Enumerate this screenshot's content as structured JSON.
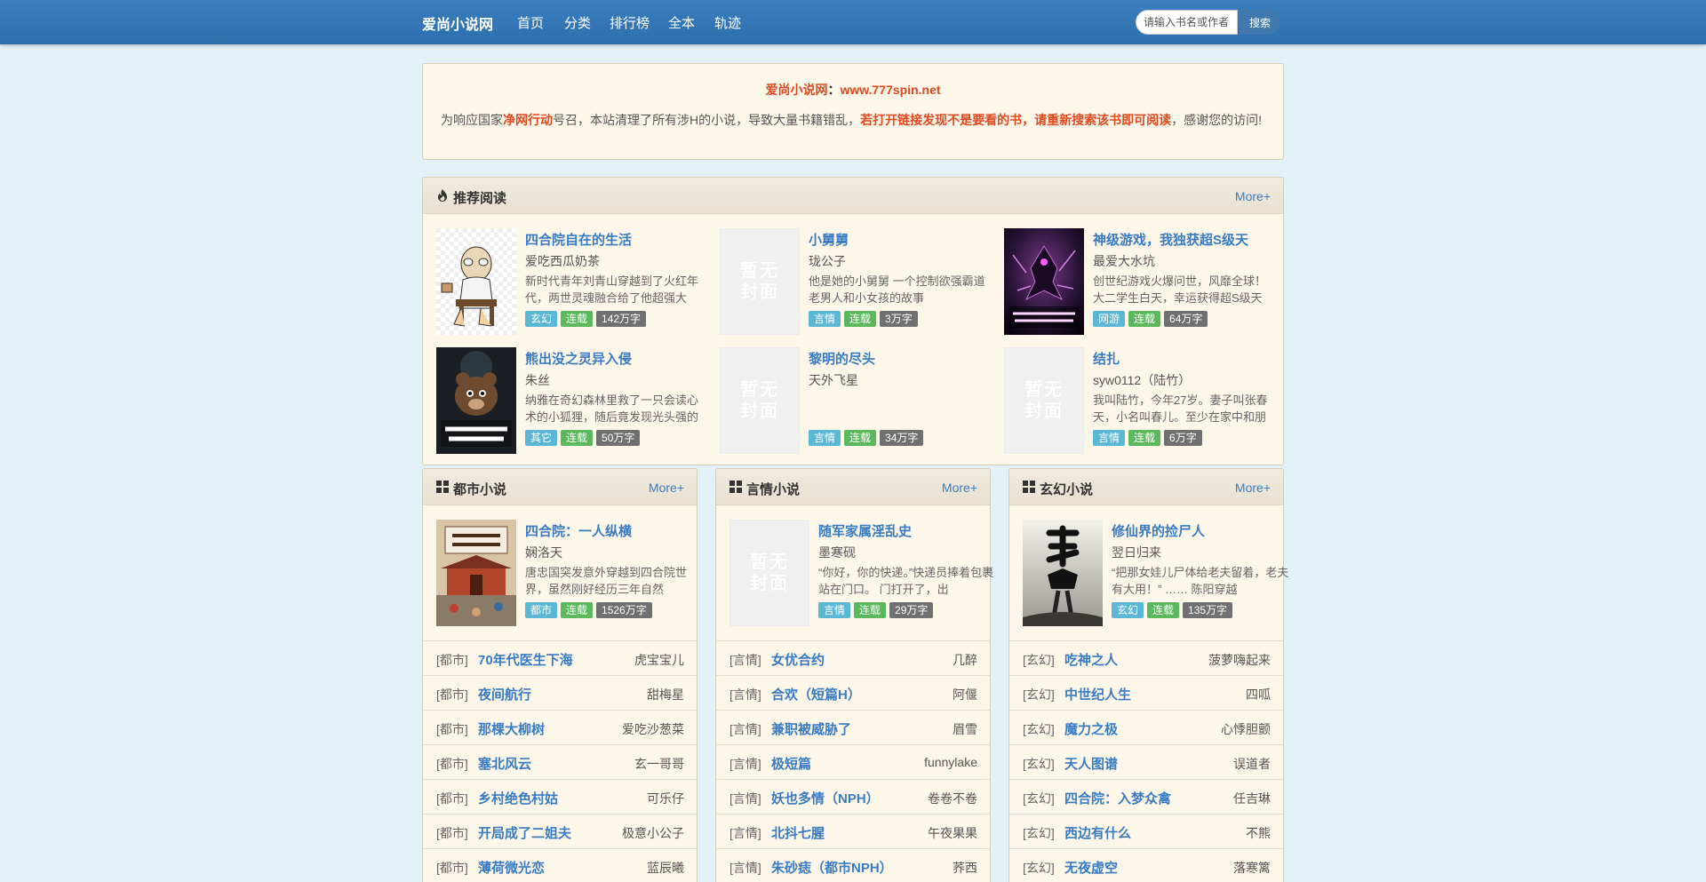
{
  "nav": {
    "brand": "爱尚小说网",
    "links": [
      "首页",
      "分类",
      "排行榜",
      "全本",
      "轨迹"
    ],
    "search_placeholder": "请输入书名或作者名",
    "search_button": "搜索"
  },
  "notice": {
    "site_name": "爱尚小说网",
    "separator": "：",
    "url": "www.777spin.net",
    "text_a": "为响应国家",
    "highlight_a": "净网行动",
    "text_b": "号召，本站清理了所有涉H的小说，导致大量书籍错乱，",
    "highlight_b": "若打开链接发现不是要看的书，请重新搜索该书即可阅读",
    "text_c": "，感谢您的访问!"
  },
  "recommend": {
    "title": "推荐阅读",
    "more": "More+",
    "books": [
      {
        "title": "四合院自在的生活",
        "author": "爱吃西瓜奶茶",
        "desc": "新时代青年刘青山穿越到了火红年代，两世灵魂融合给了他超强大",
        "genre": "玄幻",
        "status": "连载",
        "words": "142万字",
        "cover": "oldman"
      },
      {
        "title": "小舅舅",
        "author": "珑公子",
        "desc": "他是她的小舅舅 一个控制欲强霸道老男人和小女孩的故事",
        "genre": "言情",
        "status": "连载",
        "words": "3万字",
        "cover": "none"
      },
      {
        "title": "神级游戏，我独获超S级天",
        "author": "最爱大水坑",
        "desc": "创世纪游戏火爆问世，风靡全球！大二学生白天，幸运获得超S级天",
        "genre": "网游",
        "status": "连载",
        "words": "64万字",
        "cover": "game"
      },
      {
        "title": "熊出没之灵异入侵",
        "author": "朱丝",
        "desc": "纳雅在奇幻森林里救了一只会读心术的小狐狸，随后竟发现光头强的",
        "genre": "其它",
        "status": "连载",
        "words": "50万字",
        "cover": "bear"
      },
      {
        "title": "黎明的尽头",
        "author": "天外飞星",
        "desc": "",
        "genre": "言情",
        "status": "连载",
        "words": "34万字",
        "cover": "none"
      },
      {
        "title": "结扎",
        "author": "syw0112（陆竹）",
        "desc": "我叫陆竹，今年27岁。妻子叫张春天，小名叫春儿。至少在家中和朋",
        "genre": "言情",
        "status": "连载",
        "words": "6万字",
        "cover": "none"
      }
    ]
  },
  "nocover_text": [
    "暂无",
    "封面"
  ],
  "categories": [
    {
      "title": "都市小说",
      "more": "More+",
      "prefix": "[都市]",
      "featured": {
        "title": "四合院：一人纵横",
        "author": "娴洛天",
        "desc": "唐忠国突发意外穿越到四合院世界，虽然刚好经历三年自然",
        "genre": "都市",
        "status": "连载",
        "words": "1526万字",
        "cover": "siheyuan"
      },
      "list": [
        {
          "book": "70年代医生下海",
          "author": "虎宝宝儿"
        },
        {
          "book": "夜间航行",
          "author": "甜梅星"
        },
        {
          "book": "那棵大柳树",
          "author": "爱吃沙葱菜"
        },
        {
          "book": "塞北风云",
          "author": "玄一哥哥"
        },
        {
          "book": "乡村绝色村姑",
          "author": "可乐仔"
        },
        {
          "book": "开局成了二姐夫",
          "author": "极意小公子"
        },
        {
          "book": "薄荷微光恋",
          "author": "蓝辰曦"
        }
      ]
    },
    {
      "title": "言情小说",
      "more": "More+",
      "prefix": "[言情]",
      "featured": {
        "title": "随军家属淫乱史",
        "author": "墨寒砚",
        "desc": "“你好，你的快递。”快递员捧着包裹站在门口。 门打开了，出",
        "genre": "言情",
        "status": "连载",
        "words": "29万字",
        "cover": "none"
      },
      "list": [
        {
          "book": "女优合约",
          "author": "几醉"
        },
        {
          "book": "合欢（短篇H）",
          "author": "阿偃"
        },
        {
          "book": "兼职被威胁了",
          "author": "眉雪"
        },
        {
          "book": "极短篇",
          "author": "funnylake"
        },
        {
          "book": "妖也多情（NPH）",
          "author": "卷卷不卷"
        },
        {
          "book": "北抖七腥",
          "author": "午夜果果"
        },
        {
          "book": "朱砂痣（都市NPH）",
          "author": "荞西"
        }
      ]
    },
    {
      "title": "玄幻小说",
      "more": "More+",
      "prefix": "[玄幻]",
      "featured": {
        "title": "修仙界的捡尸人",
        "author": "翌日归来",
        "desc": "“把那女娃儿尸体给老夫留着，老夫有大用！” …… 陈阳穿越",
        "genre": "玄幻",
        "status": "连载",
        "words": "135万字",
        "cover": "jianshi"
      },
      "list": [
        {
          "book": "吃神之人",
          "author": "菠萝嗨起来"
        },
        {
          "book": "中世纪人生",
          "author": "四呱"
        },
        {
          "book": "魔力之极",
          "author": "心悸胆颤"
        },
        {
          "book": "天人图谱",
          "author": "误道者"
        },
        {
          "book": "四合院：入梦众禽",
          "author": "任吉琳"
        },
        {
          "book": "西边有什么",
          "author": "不熊"
        },
        {
          "book": "无夜虚空",
          "author": "落寒篱"
        }
      ]
    }
  ]
}
